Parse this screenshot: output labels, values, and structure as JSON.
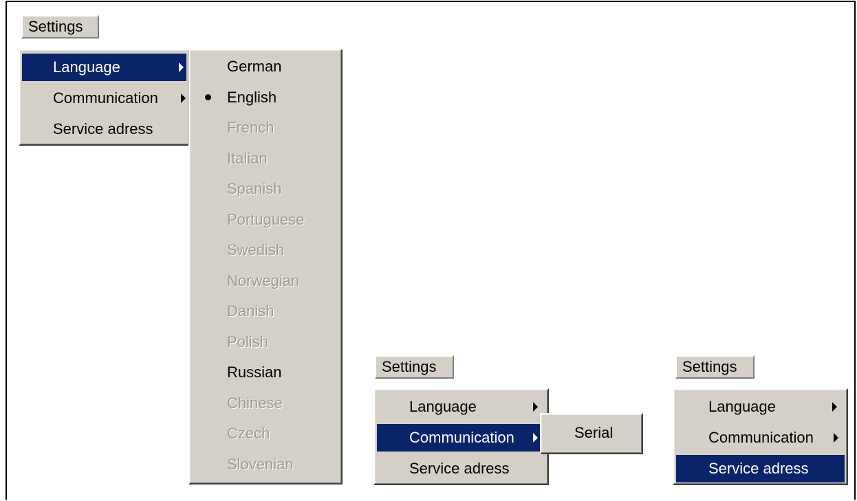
{
  "menu_a": {
    "menubar_label": "Settings",
    "items": [
      {
        "label": "Language",
        "highlight": true,
        "submenu_arrow": true
      },
      {
        "label": "Communication",
        "highlight": false,
        "submenu_arrow": true
      },
      {
        "label": "Service adress",
        "highlight": false,
        "submenu_arrow": false
      }
    ],
    "language_submenu": [
      {
        "label": "German",
        "enabled": true,
        "checked": false
      },
      {
        "label": "English",
        "enabled": true,
        "checked": true
      },
      {
        "label": "French",
        "enabled": false,
        "checked": false
      },
      {
        "label": "Italian",
        "enabled": false,
        "checked": false
      },
      {
        "label": "Spanish",
        "enabled": false,
        "checked": false
      },
      {
        "label": "Portuguese",
        "enabled": false,
        "checked": false
      },
      {
        "label": "Swedish",
        "enabled": false,
        "checked": false
      },
      {
        "label": "Norwegian",
        "enabled": false,
        "checked": false
      },
      {
        "label": "Danish",
        "enabled": false,
        "checked": false
      },
      {
        "label": "Polish",
        "enabled": false,
        "checked": false
      },
      {
        "label": "Russian",
        "enabled": true,
        "checked": false
      },
      {
        "label": "Chinese",
        "enabled": false,
        "checked": false
      },
      {
        "label": "Czech",
        "enabled": false,
        "checked": false
      },
      {
        "label": "Slovenian",
        "enabled": false,
        "checked": false
      }
    ]
  },
  "menu_b": {
    "menubar_label": "Settings",
    "items": [
      {
        "label": "Language",
        "highlight": false,
        "submenu_arrow": true
      },
      {
        "label": "Communication",
        "highlight": true,
        "submenu_arrow": true
      },
      {
        "label": "Service adress",
        "highlight": false,
        "submenu_arrow": false
      }
    ],
    "communication_submenu": [
      {
        "label": "Serial",
        "enabled": true
      }
    ]
  },
  "menu_c": {
    "menubar_label": "Settings",
    "items": [
      {
        "label": "Language",
        "highlight": false,
        "submenu_arrow": true
      },
      {
        "label": "Communication",
        "highlight": false,
        "submenu_arrow": true
      },
      {
        "label": "Service adress",
        "highlight": true,
        "submenu_arrow": false
      }
    ]
  },
  "colors": {
    "menu_face": "#d4d0c8",
    "highlight": "#0a246a",
    "highlight_text": "#ffffff",
    "disabled_text": "#9f9d98"
  }
}
